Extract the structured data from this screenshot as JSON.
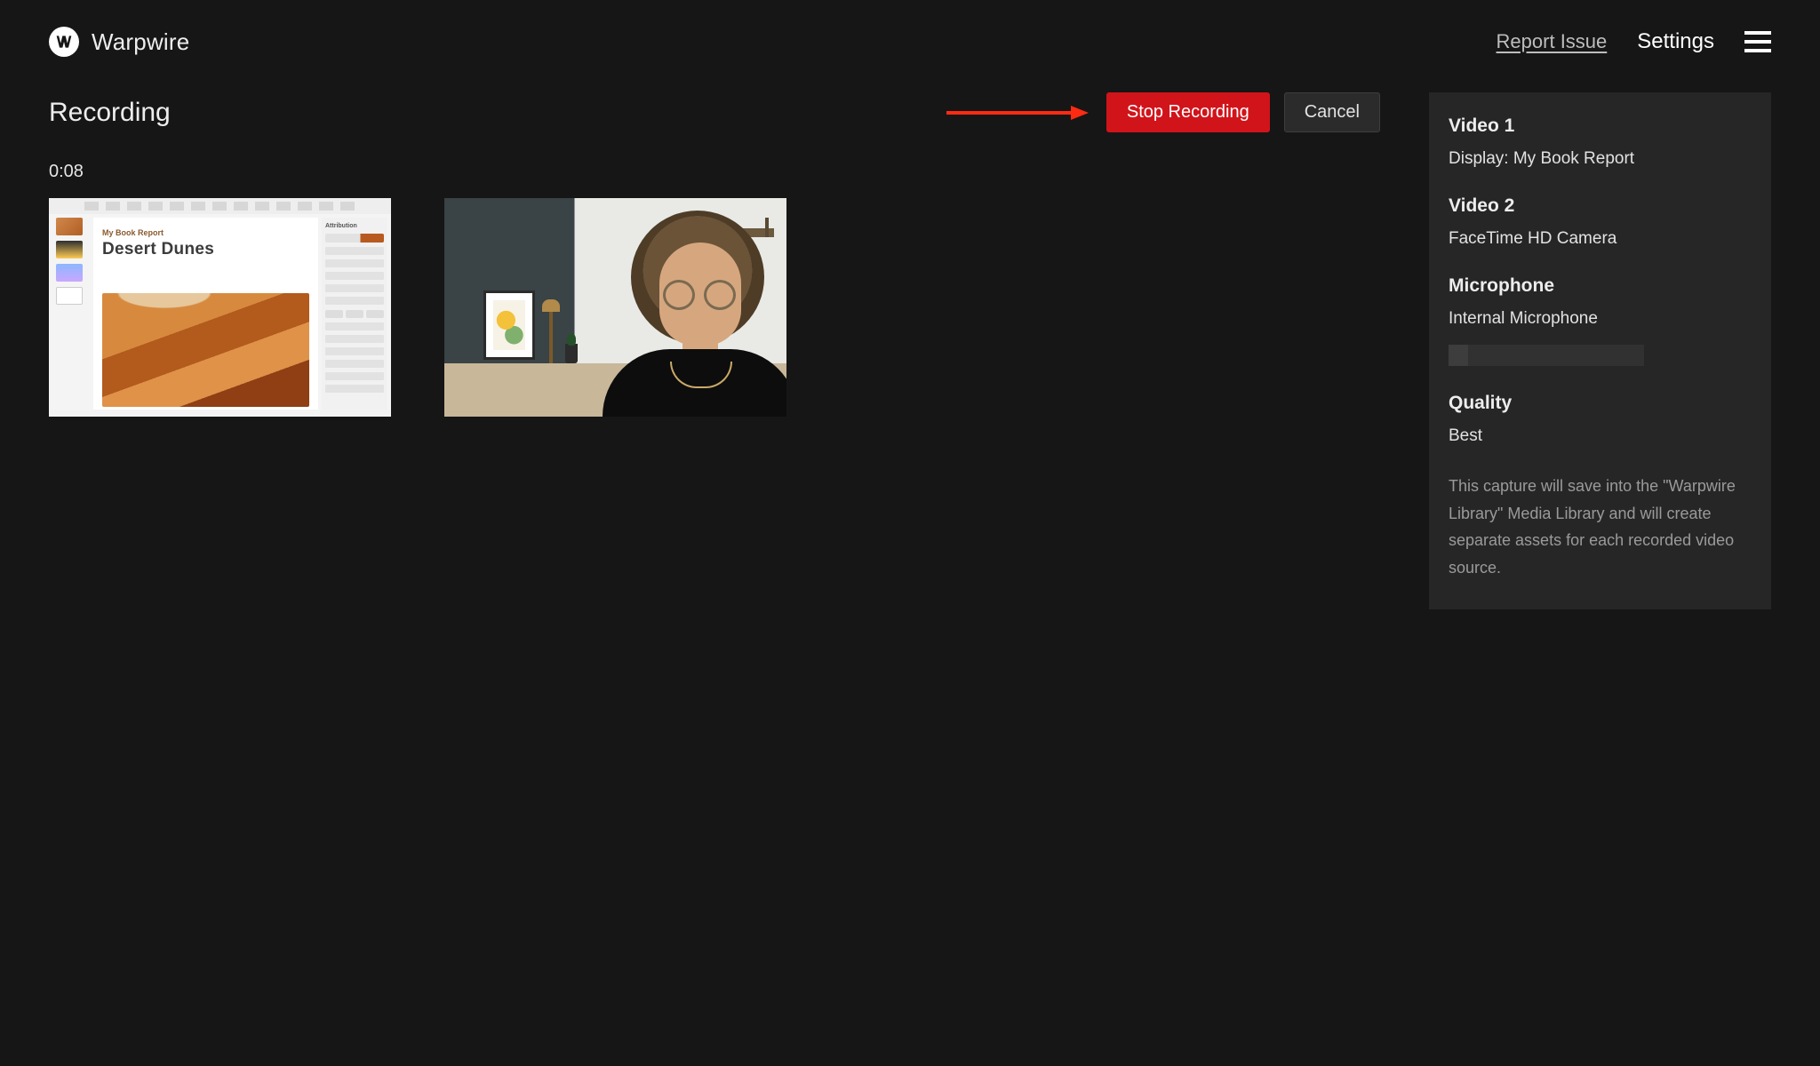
{
  "brand": {
    "name": "Warpwire"
  },
  "header": {
    "report_issue": "Report Issue",
    "settings": "Settings"
  },
  "page": {
    "title": "Recording",
    "stop_label": "Stop Recording",
    "cancel_label": "Cancel",
    "timer": "0:08"
  },
  "preview": {
    "doc_subtitle": "My Book Report",
    "doc_title": "Desert Dunes",
    "panel_header": "Attribution"
  },
  "panel": {
    "video1_heading": "Video 1",
    "video1_value": "Display: My Book Report",
    "video2_heading": "Video 2",
    "video2_value": "FaceTime HD Camera",
    "mic_heading": "Microphone",
    "mic_value": "Internal Microphone",
    "quality_heading": "Quality",
    "quality_value": "Best",
    "note": "This capture will save into the \"Warpwire Library\" Media Library and will create separate assets for each recorded video source."
  },
  "meter_levels": [
    true,
    false,
    false,
    false,
    false,
    false,
    false,
    false,
    false,
    false
  ]
}
